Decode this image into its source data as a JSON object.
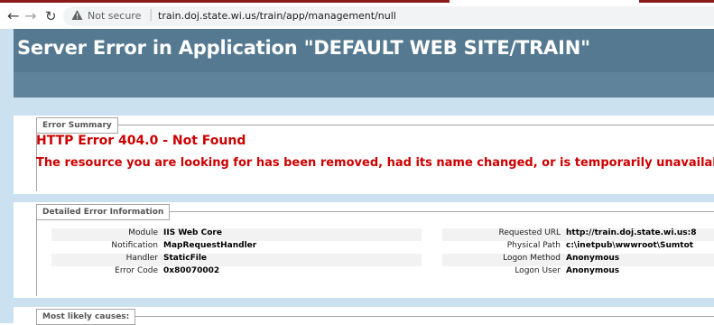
{
  "browser": {
    "security_label": "Not secure",
    "separator": "|",
    "url": "train.doj.state.wi.us/train/app/management/null"
  },
  "page": {
    "title": "Server Error in Application \"DEFAULT WEB SITE/TRAIN\""
  },
  "error_summary": {
    "legend": "Error Summary",
    "heading": "HTTP Error 404.0 - Not Found",
    "description": "The resource you are looking for has been removed, had its name changed, or is temporarily unavailal"
  },
  "detailed": {
    "legend": "Detailed Error Information",
    "left": [
      {
        "label": "Module",
        "value": "IIS Web Core"
      },
      {
        "label": "Notification",
        "value": "MapRequestHandler"
      },
      {
        "label": "Handler",
        "value": "StaticFile"
      },
      {
        "label": "Error Code",
        "value": "0x80070002"
      }
    ],
    "right": [
      {
        "label": "Requested URL",
        "value": "http://train.doj.state.wi.us:8"
      },
      {
        "label": "Physical Path",
        "value": "c:\\inetpub\\wwwroot\\Sumtot"
      },
      {
        "label": "Logon Method",
        "value": "Anonymous"
      },
      {
        "label": "Logon User",
        "value": "Anonymous"
      }
    ]
  },
  "most_likely": {
    "legend": "Most likely causes:"
  },
  "colors": {
    "banner": "#547990",
    "page_bg": "#cbe1ef",
    "error_red": "#cc0000"
  }
}
